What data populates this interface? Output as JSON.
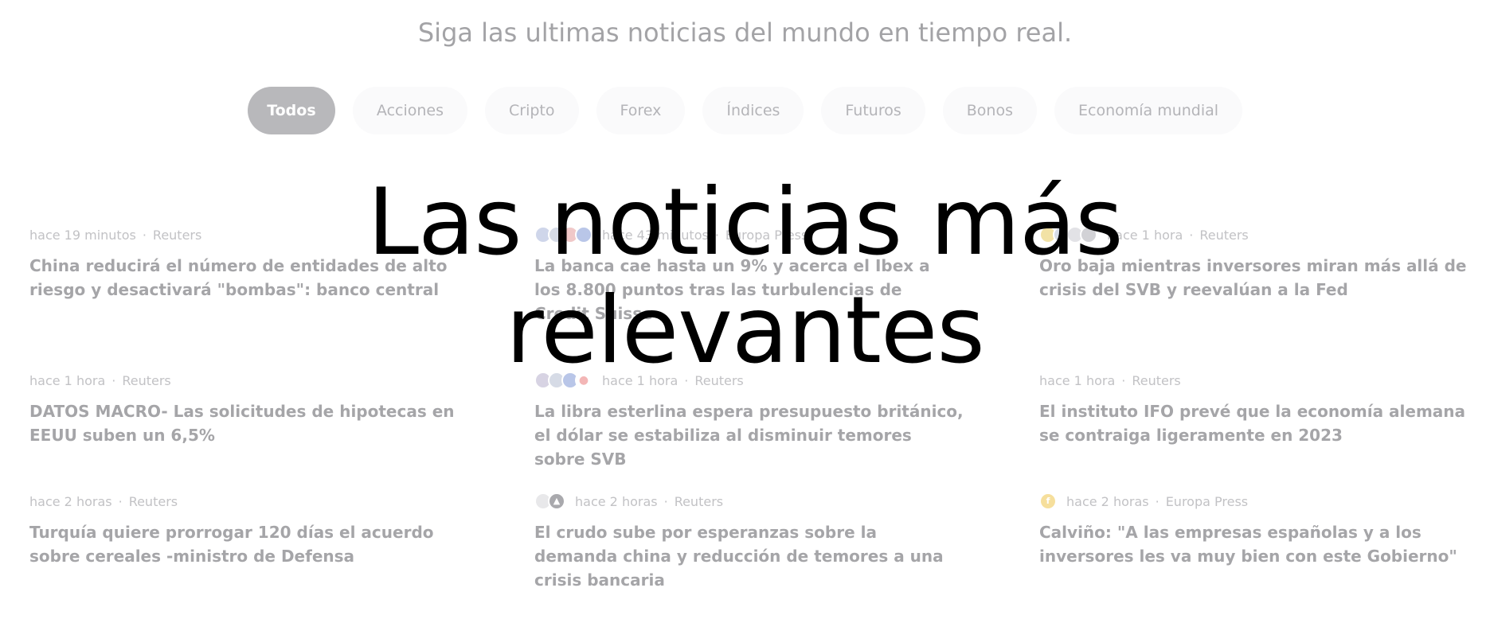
{
  "subtitle": "Siga las ultimas noticias del mundo en tiempo real.",
  "tabs": [
    {
      "label": "Todos",
      "active": true
    },
    {
      "label": "Acciones"
    },
    {
      "label": "Cripto"
    },
    {
      "label": "Forex"
    },
    {
      "label": "Índices"
    },
    {
      "label": "Futuros"
    },
    {
      "label": "Bonos"
    },
    {
      "label": "Economía mundial"
    }
  ],
  "hero": {
    "line1": "Las noticias más",
    "line2": "relevantes"
  },
  "news": [
    {
      "time": "hace 19 minutos",
      "source": "Reuters",
      "headline": "China reducirá el número de entidades de alto riesgo y desactivará \"bombas\": banco central",
      "icons": []
    },
    {
      "time": "hace 43 minutos",
      "source": "Europa Press",
      "headline": "La banca cae hasta un 9% y acerca el Ibex a los 8.800 puntos tras las turbulencias de Credit Suisse",
      "icons": [
        "flag-icon",
        "flag-icon",
        "flag-icon",
        "flag-icon"
      ]
    },
    {
      "time": "hace 1 hora",
      "source": "Reuters",
      "headline": "Oro baja mientras inversores miran más allá de crisis del SVB y reevalúan a la Fed",
      "icons": [
        "gold-icon",
        "flag-icon",
        "flag-icon",
        "cloud-icon"
      ]
    },
    {
      "time": "hace 1 hora",
      "source": "Reuters",
      "headline": "DATOS MACRO- Las solicitudes de hipotecas en EEUU suben un 6,5%",
      "icons": []
    },
    {
      "time": "hace 1 hora",
      "source": "Reuters",
      "headline": "La libra esterlina espera presupuesto británico, el dólar se estabiliza al disminuir temores sobre SVB",
      "icons": [
        "uk-flag-icon",
        "us-flag-icon",
        "eu-flag-icon",
        "japan-flag-icon"
      ]
    },
    {
      "time": "hace 1 hora",
      "source": "Reuters",
      "headline": "El instituto IFO prevé que la economía alemana se contraiga ligeramente en 2023",
      "icons": []
    },
    {
      "time": "hace 2 horas",
      "source": "Reuters",
      "headline": "Turquía quiere prorrogar 120 días el acuerdo sobre cereales -ministro de Defensa",
      "icons": []
    },
    {
      "time": "hace 2 horas",
      "source": "Reuters",
      "headline": "El crudo sube por esperanzas sobre la demanda china y reducción de temores a una crisis bancaria",
      "icons": [
        "oil-icon",
        "drop-icon"
      ]
    },
    {
      "time": "hace 2 horas",
      "source": "Europa Press",
      "headline": "Calviño: \"A las empresas españolas y a los inversores les va muy bien con este Gobierno\"",
      "icons": [
        "company-logo-icon"
      ]
    }
  ],
  "sep": "·"
}
